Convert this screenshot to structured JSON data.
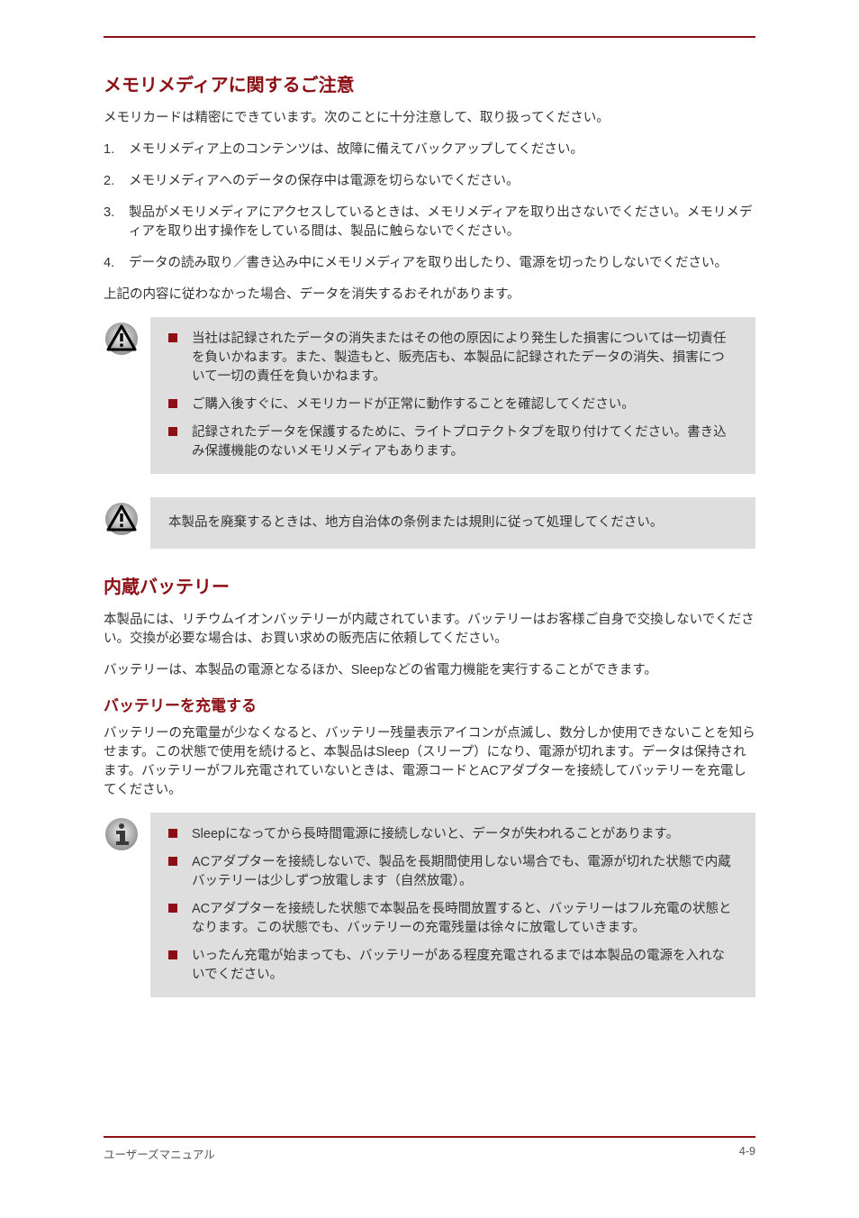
{
  "sections": {
    "memory_title": "メモリメディアに関するご注意",
    "memory_p1": "メモリカードは精密にできています。次のことに十分注意して、取り扱ってください。",
    "memory_step1_num": "1.",
    "memory_step1_text": "メモリメディア上のコンテンツは、故障に備えてバックアップしてください。",
    "memory_step2_num": "2.",
    "memory_step2_text": "メモリメディアへのデータの保存中は電源を切らないでください。",
    "memory_step3_num": "3.",
    "memory_step3_text": "製品がメモリメディアにアクセスしているときは、メモリメディアを取り出さないでください。メモリメディアを取り出す操作をしている間は、製品に触らないでください。",
    "memory_step4_num": "4.",
    "memory_step4_text": "データの読み取り／書き込み中にメモリメディアを取り出したり、電源を切ったりしないでください。",
    "memory_p2": "上記の内容に従わなかった場合、データを消失するおそれがあります。",
    "callout1_items": [
      "当社は記録されたデータの消失またはその他の原因により発生した損害については一切責任を負いかねます。また、製造もと、販売店も、本製品に記録されたデータの消失、損害について一切の責任を負いかねます。",
      "ご購入後すぐに、メモリカードが正常に動作することを確認してください。",
      "記録されたデータを保護するために、ライトプロテクトタブを取り付けてください。書き込み保護機能のないメモリメディアもあります。"
    ],
    "callout2_text": "本製品を廃棄するときは、地方自治体の条例または規則に従って処理してください。",
    "battery_title": "内蔵バッテリー",
    "battery_p1": "本製品には、リチウムイオンバッテリーが内蔵されています。バッテリーはお客様ご自身で交換しないでください。交換が必要な場合は、お買い求めの販売店に依頼してください。",
    "battery_p2": "バッテリーは、本製品の電源となるほか、Sleepなどの省電力機能を実行することができます。",
    "battery_sub": "バッテリーを充電する",
    "battery_sub_p": "バッテリーの充電量が少なくなると、バッテリー残量表示アイコンが点滅し、数分しか使用できないことを知らせます。この状態で使用を続けると、本製品はSleep（スリープ）になり、電源が切れます。データは保持されます。バッテリーがフル充電されていないときは、電源コードとACアダプターを接続してバッテリーを充電してください。",
    "callout3_items": [
      "Sleepになってから長時間電源に接続しないと、データが失われることがあります。",
      "ACアダプターを接続しないで、製品を長期間使用しない場合でも、電源が切れた状態で内蔵バッテリーは少しずつ放電します（自然放電）。",
      "ACアダプターを接続した状態で本製品を長時間放置すると、バッテリーはフル充電の状態となります。この状態でも、バッテリーの充電残量は徐々に放電していきます。",
      "いったん充電が始まっても、バッテリーがある程度充電されるまでは本製品の電源を入れないでください。"
    ]
  },
  "footer": {
    "left": "ユーザーズマニュアル",
    "right": "4-9"
  }
}
